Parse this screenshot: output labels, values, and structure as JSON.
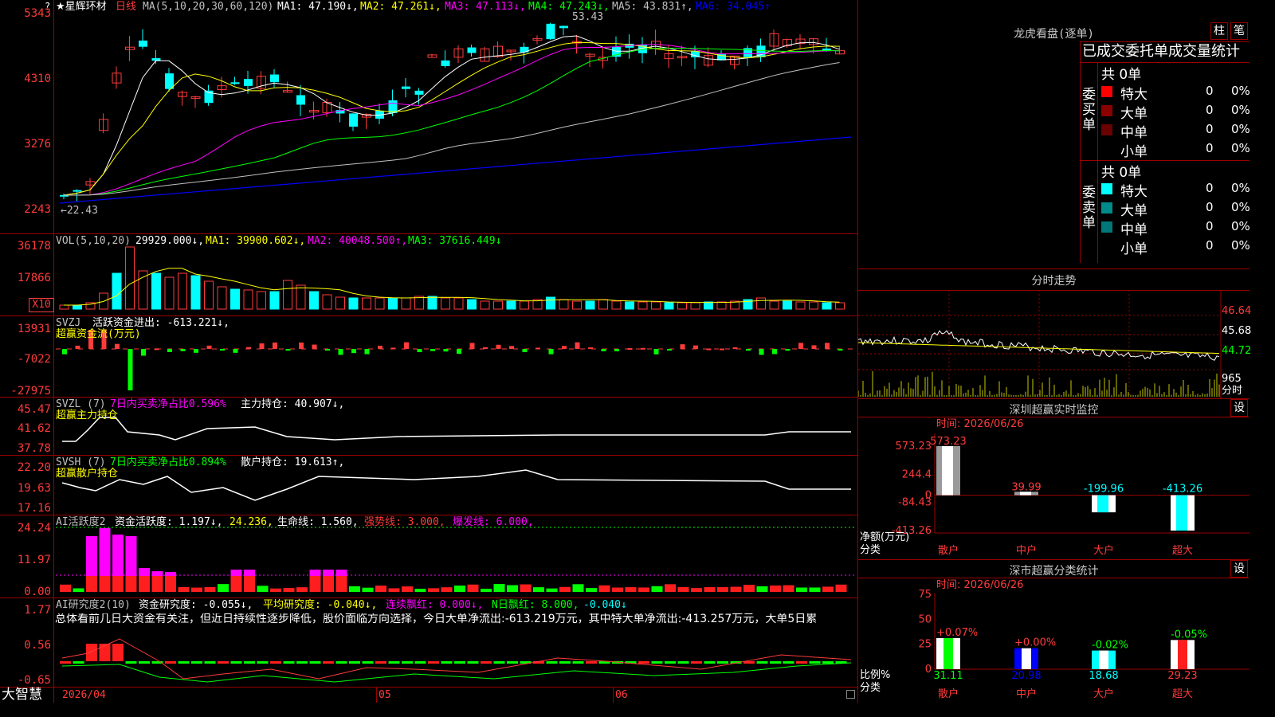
{
  "stock": {
    "name": "★星辉环材",
    "period": "日线"
  },
  "main_panel": {
    "ma_title": "MA(5,10,20,30,60,120)",
    "ma1": "MA1: 47.190↓,",
    "ma2": "MA2: 47.261↓,",
    "ma3": "MA3: 47.113↓,",
    "ma4": "MA4: 47.243↓,",
    "ma5": "MA5: 43.831↑,",
    "ma6": "MA6: 34.045↑",
    "ylabels": [
      "5343",
      "4310",
      "3276",
      "2243"
    ],
    "high_label": "53.43",
    "low_label": "←22.43",
    "question": "?"
  },
  "vol_panel": {
    "title": "VOL(5,10,20)",
    "value": "29929.000↓,",
    "ma1": "MA1: 39900.602↓,",
    "ma2": "MA2: 40048.500↑,",
    "ma3": "MA3: 37616.449↓",
    "ylabels": [
      "36178",
      "17866"
    ],
    "unit": "X10"
  },
  "svzj_panel": {
    "title": "SVZJ",
    "line": "活跃资金进出: -613.221↓,",
    "subtitle": "超赢资金流(万元)",
    "ylabels": [
      "13931",
      "-7022",
      "-27975"
    ]
  },
  "svzl_panel": {
    "title": "SVZL (7)",
    "pct": "7日内买卖净占比0.596%",
    "line": "主力持仓: 40.907↓,",
    "subtitle": "超赢主力持仓",
    "ylabels": [
      "45.47",
      "41.62",
      "37.78"
    ]
  },
  "svsh_panel": {
    "title": "SVSH (7)",
    "pct": "7日内买卖净占比0.894%",
    "line": "散户持仓: 19.613↑,",
    "subtitle": "超赢散户持仓",
    "ylabels": [
      "22.20",
      "19.63",
      "17.16"
    ]
  },
  "ai_act_panel": {
    "title": "AI活跃度2",
    "v1": "资金活跃度: 1.197↓,",
    "v2": "24.236,",
    "v3": "生命线: 1.560,",
    "v4": "强势线: 3.000,",
    "v5": "爆发线: 6.000,",
    "ylabels": [
      "24.24",
      "11.97",
      "0.00"
    ]
  },
  "ai_res_panel": {
    "title": "AI研究度2(10)",
    "v1": "资金研究度: -0.055↓,",
    "v2": "平均研究度: -0.040↓,",
    "v3": "连续飘红: 0.000↓,",
    "v4": "N日飘红: 8.000,",
    "v5": "-0.040↓",
    "comment": "总体看前几日大资金有关注，但近日持续性逐步降低，股价面临方向选择，今日大单净流出:-613.219万元，其中特大单净流出:-413.257万元，大单5日累",
    "ylabels": [
      "1.77",
      "0.56",
      "-0.65"
    ]
  },
  "bottom_bar": {
    "brand": "大智慧",
    "date_label": "2026/04",
    "month2": "05",
    "month3": "06"
  },
  "longhu": {
    "title": "龙虎看盘(逐单)",
    "btn_zhu": "柱",
    "btn_bi": "笔",
    "stats_title": "已成交委托单成交量统计",
    "buy_label": "委买单",
    "sell_label": "委卖单",
    "buy_total": "共 0单",
    "sell_total": "共 0单",
    "buy_rows": [
      {
        "name": "特大",
        "count": "0",
        "pct": "0%",
        "color": "#ff0000"
      },
      {
        "name": "大单",
        "count": "0",
        "pct": "0%",
        "color": "#8b0000"
      },
      {
        "name": "中单",
        "count": "0",
        "pct": "0%",
        "color": "#6b0000"
      },
      {
        "name": "小单",
        "count": "0",
        "pct": "0%",
        "color": ""
      }
    ],
    "sell_rows": [
      {
        "name": "特大",
        "count": "0",
        "pct": "0%",
        "color": "#00ffff"
      },
      {
        "name": "大单",
        "count": "0",
        "pct": "0%",
        "color": "#008b8b"
      },
      {
        "name": "中单",
        "count": "0",
        "pct": "0%",
        "color": "#007878"
      },
      {
        "name": "小单",
        "count": "0",
        "pct": "0%",
        "color": ""
      }
    ]
  },
  "intraday": {
    "title": "分时走势",
    "ylabels": [
      "46.64",
      "45.68",
      "44.72"
    ],
    "vol_label": "965",
    "fen_label": "分时"
  },
  "monitor": {
    "title": "深圳超赢实时监控",
    "set_btn": "设",
    "time_label": "时间: 2026/06/26",
    "ylabels": [
      "573.23",
      "244.4",
      "0",
      "-84.43",
      "-413.26"
    ],
    "axis_label_1": "净额(万元)",
    "axis_label_2": "分类",
    "categories": [
      "散户",
      "中户",
      "大户",
      "超大"
    ],
    "value_labels": [
      "573.23",
      "39.99",
      "-199.96",
      "-413.26"
    ]
  },
  "classify": {
    "title": "深市超赢分类统计",
    "set_btn": "设",
    "time_label": "时间: 2026/06/26",
    "ylabels": [
      "75",
      "50",
      "25",
      "0"
    ],
    "axis_label_1": "比例%",
    "axis_label_2": "分类",
    "categories": [
      "散户",
      "中户",
      "大户",
      "超大"
    ],
    "top_labels": [
      "+0.07%",
      "+0.00%",
      "-0.02%",
      "-0.05%"
    ],
    "bottom_labels": [
      "31.11",
      "20.98",
      "18.68",
      "29.23"
    ]
  },
  "chart_data": [
    {
      "type": "bar",
      "title": "深圳超赢实时监控",
      "ylabel": "净额(万元)",
      "xlabel": "分类",
      "categories": [
        "散户",
        "中户",
        "大户",
        "超大"
      ],
      "values": [
        573.23,
        39.99,
        -199.96,
        -413.26
      ],
      "ylim": [
        -413.26,
        573.23
      ]
    },
    {
      "type": "bar",
      "title": "深市超赢分类统计",
      "ylabel": "比例%",
      "xlabel": "分类",
      "categories": [
        "散户",
        "中户",
        "大户",
        "超大"
      ],
      "values": [
        31.11,
        20.98,
        18.68,
        29.23
      ],
      "ylim": [
        0,
        75
      ]
    }
  ],
  "colors": {
    "up": "#ff3b3b",
    "down": "#00ffff",
    "grid": "#9a0000",
    "bg": "#000000"
  }
}
